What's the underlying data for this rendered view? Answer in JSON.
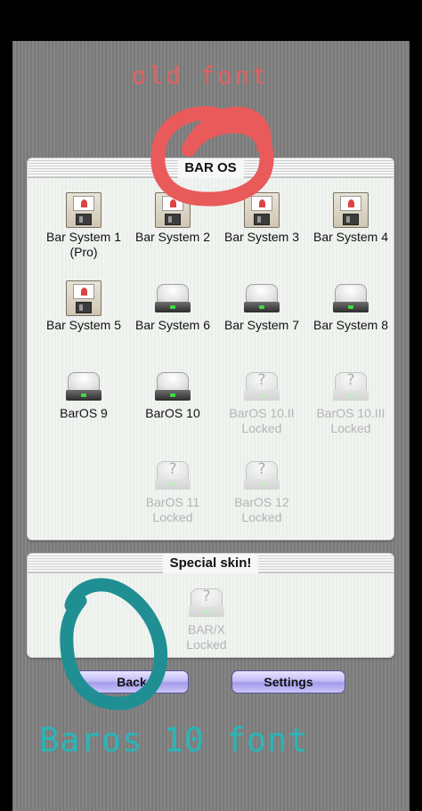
{
  "annotations": {
    "old_font": "old font",
    "baros_font": "Baros 10 font"
  },
  "main_window": {
    "title": "BAR OS",
    "items": [
      {
        "label": "Bar System 1",
        "sub": "(Pro)",
        "icon": "floppy-disk-icon",
        "locked": false
      },
      {
        "label": "Bar System 2",
        "sub": "",
        "icon": "floppy-disk-icon",
        "locked": false
      },
      {
        "label": "Bar System 3",
        "sub": "",
        "icon": "floppy-disk-icon",
        "locked": false
      },
      {
        "label": "Bar System 4",
        "sub": "",
        "icon": "floppy-disk-icon",
        "locked": false
      },
      {
        "label": "Bar System 5",
        "sub": "",
        "icon": "floppy-disk-icon",
        "locked": false
      },
      {
        "label": "Bar System 6",
        "sub": "",
        "icon": "hard-disk-icon",
        "locked": false
      },
      {
        "label": "Bar System 7",
        "sub": "",
        "icon": "hard-disk-icon",
        "locked": false
      },
      {
        "label": "Bar System 8",
        "sub": "",
        "icon": "hard-disk-icon",
        "locked": false
      },
      {
        "label": "BarOS 9",
        "sub": "",
        "icon": "hard-disk-icon",
        "locked": false
      },
      {
        "label": "BarOS 10",
        "sub": "",
        "icon": "hard-disk-icon",
        "locked": false
      },
      {
        "label": "BarOS 10.II",
        "sub": "Locked",
        "icon": "locked-disk-icon",
        "locked": true
      },
      {
        "label": "BarOS 10.III",
        "sub": "Locked",
        "icon": "locked-disk-icon",
        "locked": true
      },
      {
        "label": "BarOS 11",
        "sub": "Locked",
        "icon": "locked-disk-icon",
        "locked": true
      },
      {
        "label": "BarOS 12",
        "sub": "Locked",
        "icon": "locked-disk-icon",
        "locked": true
      }
    ]
  },
  "special_window": {
    "title": "Special skin!",
    "items": [
      {
        "label": "BAR/X",
        "sub": "Locked",
        "icon": "locked-disk-icon",
        "locked": true
      }
    ]
  },
  "locked_glyph": "?",
  "buttons": {
    "back": "Back",
    "settings": "Settings"
  },
  "colors": {
    "annotation_red": "#e95a5a",
    "annotation_teal": "#1f8f94",
    "button": "#b8b0f2"
  }
}
